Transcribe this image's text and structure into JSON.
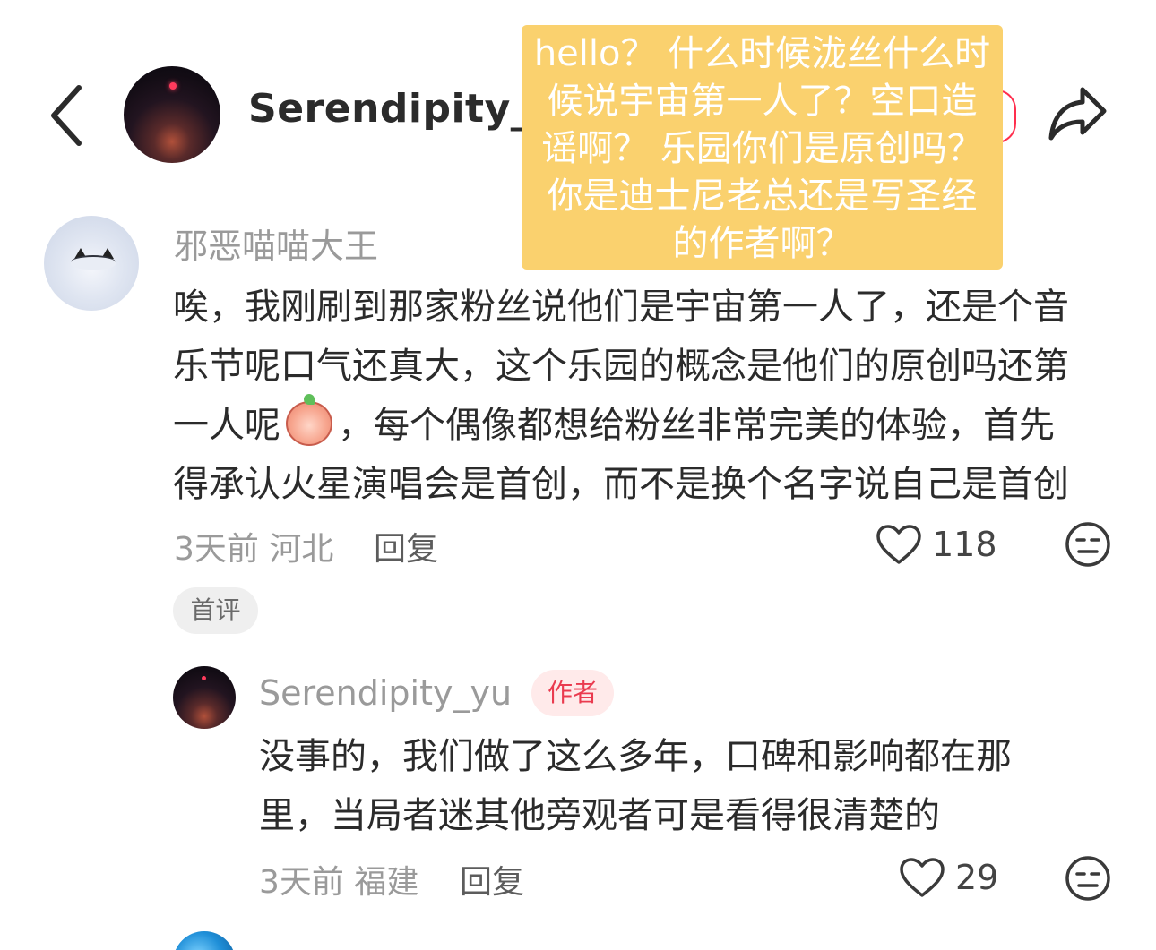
{
  "header": {
    "username": "Serendipity_yu",
    "back_icon": "chevron-left-icon",
    "share_icon": "share-arrow-icon"
  },
  "overlay_note": {
    "lines": [
      "hello？ 什么时候泷丝什么时",
      "候说宇宙第一人了？空口造",
      "谣啊？ 乐园你们是原创吗？",
      "你是迪士尼老总还是写圣经",
      "的作者啊？"
    ],
    "background": "#fad16e",
    "text_color": "#ffffff"
  },
  "comments": [
    {
      "username": "邪恶喵喵大王",
      "body_lines": [
        "唉，我刚刷到那家粉丝说他们是宇宙第一人了，还是个音",
        "乐节呢口气还真大，这个乐园的概念是他们的原创吗还第",
        "一人呢",
        "，每个偶像都想给粉丝非常完美的体验，首先",
        "得承认火星演唱会是首创，而不是换个名字说自己是首创"
      ],
      "emoji": "crying-face-emoji",
      "time": "3天前",
      "location": "河北",
      "reply_label": "回复",
      "likes": "118",
      "tag": "首评"
    },
    {
      "username": "Serendipity_yu",
      "badge": "作者",
      "body_lines": [
        "没事的，我们做了这么多年，口碑和影响都在那",
        "里，当局者迷其他旁观者可是看得很清楚的"
      ],
      "time": "3天前",
      "location": "福建",
      "reply_label": "回复",
      "likes": "29"
    }
  ],
  "colors": {
    "accent": "#ff2e4d",
    "author_badge_bg": "#ffeaea",
    "author_badge_text": "#ea3b4f",
    "muted_text": "#9a9a9a"
  }
}
